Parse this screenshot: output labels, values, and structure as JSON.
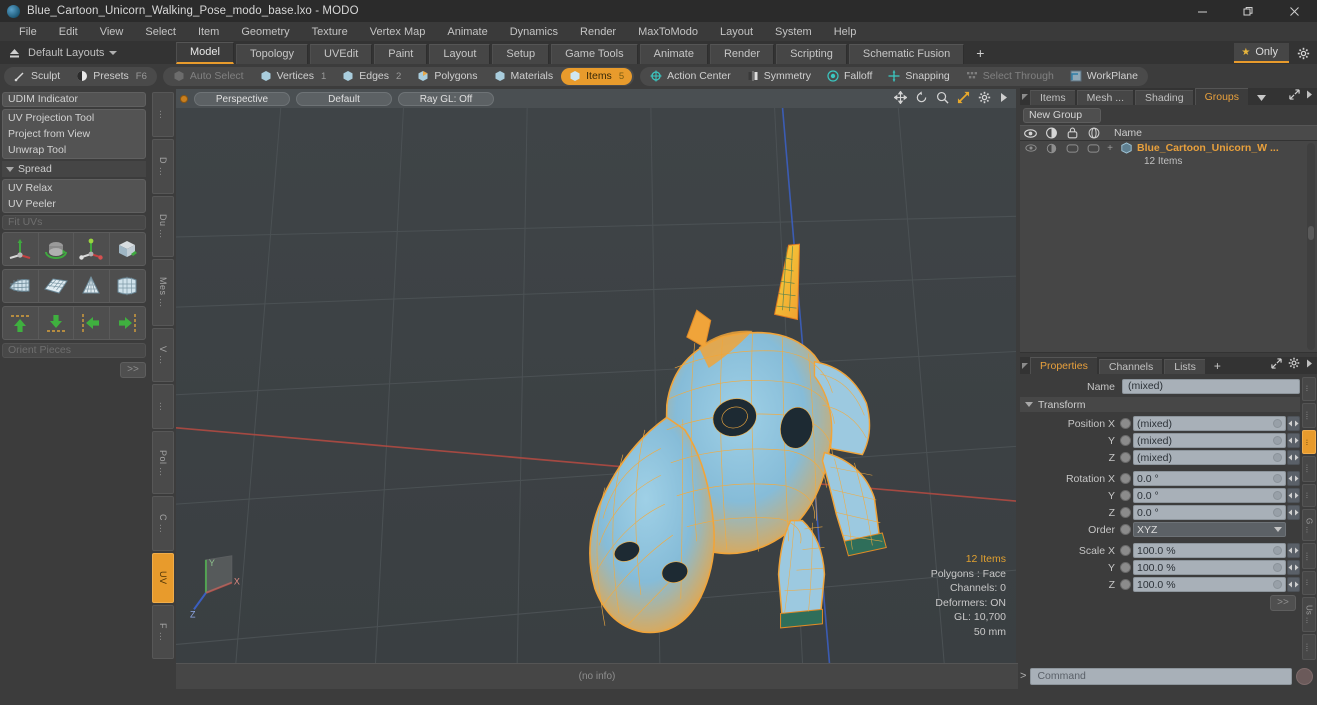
{
  "window": {
    "title": "Blue_Cartoon_Unicorn_Walking_Pose_modo_base.lxo - MODO",
    "minimize": "minimize-button",
    "restore": "restore-button",
    "close": "close-button"
  },
  "menubar": {
    "items": [
      "File",
      "Edit",
      "View",
      "Select",
      "Item",
      "Geometry",
      "Texture",
      "Vertex Map",
      "Animate",
      "Dynamics",
      "Render",
      "MaxToModo",
      "Layout",
      "System",
      "Help"
    ]
  },
  "layoutbar": {
    "layouts_label": "Default Layouts",
    "tabs": [
      {
        "label": "Model",
        "active": true
      },
      {
        "label": "Topology",
        "active": false
      },
      {
        "label": "UVEdit",
        "active": false
      },
      {
        "label": "Paint",
        "active": false
      },
      {
        "label": "Layout",
        "active": false
      },
      {
        "label": "Setup",
        "active": false
      },
      {
        "label": "Game Tools",
        "active": false
      },
      {
        "label": "Animate",
        "active": false
      },
      {
        "label": "Render",
        "active": false
      },
      {
        "label": "Scripting",
        "active": false
      },
      {
        "label": "Schematic Fusion",
        "active": false
      }
    ],
    "add_tab": "+",
    "only_label": "Only"
  },
  "toolbar": {
    "group1": [
      {
        "label": "Sculpt",
        "icon": "brush-icon",
        "state": "normal"
      },
      {
        "label": "Presets",
        "icon": "sphere-icon",
        "state": "normal",
        "shortcut": "F6"
      }
    ],
    "group2": [
      {
        "label": "Auto Select",
        "icon": "cube-icon",
        "state": "dim",
        "num": ""
      },
      {
        "label": "Vertices",
        "icon": "cube-icon",
        "state": "normal",
        "num": "1"
      },
      {
        "label": "Edges",
        "icon": "cube-icon",
        "state": "normal",
        "num": "2"
      },
      {
        "label": "Polygons",
        "icon": "cube-icon",
        "state": "normal",
        "num": ""
      },
      {
        "label": "Materials",
        "icon": "cube-icon",
        "state": "normal",
        "num": ""
      },
      {
        "label": "Items",
        "icon": "cube-icon",
        "state": "active",
        "num": "5"
      }
    ],
    "group3": [
      {
        "label": "Action Center",
        "icon": "target-icon",
        "state": "normal"
      },
      {
        "label": "Symmetry",
        "icon": "mirror-icon",
        "state": "normal"
      },
      {
        "label": "Falloff",
        "icon": "falloff-icon",
        "state": "normal"
      },
      {
        "label": "Snapping",
        "icon": "snap-icon",
        "state": "normal"
      },
      {
        "label": "Select Through",
        "icon": "select-through-icon",
        "state": "dim"
      },
      {
        "label": "WorkPlane",
        "icon": "workplane-icon",
        "state": "normal"
      }
    ]
  },
  "left_panel": {
    "rows_top": [
      "UDIM Indicator"
    ],
    "group_a": [
      "UV Projection Tool",
      "Project from View",
      "Unwrap Tool"
    ],
    "spread_header": "Spread",
    "group_b": [
      "UV Relax",
      "UV Peeler"
    ],
    "disabled_row": "Fit UVs",
    "icon_rows": [
      [
        "uv-move-gizmo-icon",
        "uv-rotate-gizmo-icon",
        "uv-scale-gizmo-icon",
        "uv-box-unwrap-icon"
      ],
      [
        "uv-fit-icon",
        "uv-grid-flatten-icon",
        "uv-cone-unwrap-icon",
        "uv-relax-mesh-icon"
      ],
      [
        "uv-move-up-icon",
        "uv-move-down-icon",
        "uv-move-left-icon",
        "uv-move-right-icon"
      ]
    ],
    "orient_row": "Orient Pieces",
    "go_label": ">>",
    "vtabs": [
      {
        "label": "...",
        "active": false
      },
      {
        "label": "D ...",
        "active": false
      },
      {
        "label": "Du ...",
        "active": false
      },
      {
        "label": "Mes ...",
        "active": false
      },
      {
        "label": "V ...",
        "active": false
      },
      {
        "label": "...",
        "active": false
      },
      {
        "label": "Pol ...",
        "active": false
      },
      {
        "label": "C ...",
        "active": false
      },
      {
        "label": "UV",
        "active": true
      },
      {
        "label": "F ...",
        "active": false
      }
    ]
  },
  "viewport": {
    "view_mode": "Perspective",
    "shading": "Default",
    "raygl": "Ray GL: Off",
    "nav_icons": [
      "pan-icon",
      "rotate-icon",
      "zoom-icon",
      "fit-icon",
      "gear-icon",
      "chevron-right-icon"
    ],
    "stats": {
      "items": "12 Items",
      "polygons": "Polygons : Face",
      "channels": "Channels: 0",
      "deformers": "Deformers: ON",
      "gl": "GL: 10,700",
      "scale": "50 mm"
    },
    "axis_gizmo": {
      "x": "X",
      "y": "Y",
      "z": "Z"
    },
    "footer": "(no info)"
  },
  "right_panel": {
    "tabs": [
      {
        "label": "Items",
        "active": false
      },
      {
        "label": "Mesh ...",
        "active": false
      },
      {
        "label": "Shading",
        "active": false
      },
      {
        "label": "Groups",
        "active": true
      }
    ],
    "add_tab": "+",
    "new_group_button": "New Group",
    "tree_columns": [
      "visibility-icon",
      "render-icon",
      "lock-icon",
      "wire-icon",
      "Name"
    ],
    "tree_rows": [
      {
        "name": "Blue_Cartoon_Unicorn_W ...",
        "sub": "12 Items"
      }
    ]
  },
  "properties": {
    "tabs": [
      {
        "label": "Properties",
        "active": true
      },
      {
        "label": "Channels",
        "active": false
      },
      {
        "label": "Lists",
        "active": false
      }
    ],
    "add_tab": "+",
    "name_label": "Name",
    "name_value": "(mixed)",
    "transform_header": "Transform",
    "fields": [
      {
        "label": "Position X",
        "value": "(mixed)",
        "type": "text"
      },
      {
        "label": "Y",
        "value": "(mixed)",
        "type": "text"
      },
      {
        "label": "Z",
        "value": "(mixed)",
        "type": "text"
      },
      {
        "label": "Rotation X",
        "value": "0.0 °",
        "type": "text"
      },
      {
        "label": "Y",
        "value": "0.0 °",
        "type": "text"
      },
      {
        "label": "Z",
        "value": "0.0 °",
        "type": "text"
      },
      {
        "label": "Order",
        "value": "XYZ",
        "type": "select"
      },
      {
        "label": "Scale X",
        "value": "100.0 %",
        "type": "text"
      },
      {
        "label": "Y",
        "value": "100.0 %",
        "type": "text"
      },
      {
        "label": "Z",
        "value": "100.0 %",
        "type": "text"
      }
    ],
    "go_label": ">>",
    "vtabs": [
      {
        "label": "...",
        "active": false
      },
      {
        "label": "....",
        "active": false
      },
      {
        "label": "...",
        "active": true
      },
      {
        "label": "....",
        "active": false
      },
      {
        "label": "...",
        "active": false
      },
      {
        "label": "G ...",
        "active": false
      },
      {
        "label": "....",
        "active": false
      },
      {
        "label": "...",
        "active": false
      },
      {
        "label": "Us ...",
        "active": false
      },
      {
        "label": "....",
        "active": false
      }
    ]
  },
  "bottom": {
    "command_placeholder": "Command",
    "chevron": ">"
  },
  "colors": {
    "accent_orange": "#e89b2c",
    "panel_bg": "#3c3c3c",
    "viewport_bg": "#3e4346",
    "field_bg": "#a8b0b8",
    "mesh_orange": "#f5a623",
    "mesh_blue": "#7fb8d8"
  }
}
